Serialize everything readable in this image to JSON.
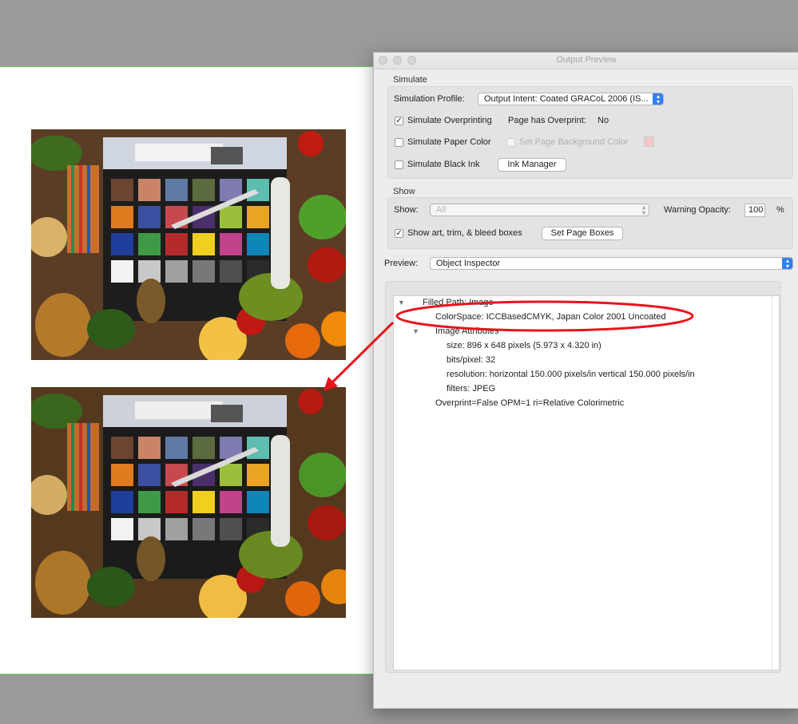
{
  "window": {
    "title": "Output Preview"
  },
  "simulate": {
    "group_label": "Simulate",
    "profile_label": "Simulation Profile:",
    "profile_value": "Output Intent: Coated GRACoL 2006 (IS...",
    "overprinting_label": "Simulate Overprinting",
    "overprinting_checked": true,
    "page_overprint_label": "Page has Overprint:",
    "page_overprint_value": "No",
    "paper_color_label": "Simulate Paper Color",
    "page_bg_label": "Set Page Background Color",
    "page_bg_color": "#f3c8c8",
    "black_ink_label": "Simulate Black Ink",
    "ink_manager_label": "Ink Manager"
  },
  "show": {
    "group_label": "Show",
    "show_label": "Show:",
    "show_value": "All",
    "warning_opacity_label": "Warning Opacity:",
    "warning_opacity_value": "100",
    "percent_label": "%",
    "boxes_label": "Show art, trim, & bleed boxes",
    "boxes_checked": true,
    "set_page_boxes_label": "Set Page Boxes"
  },
  "preview": {
    "label": "Preview:",
    "value": "Object Inspector"
  },
  "inspector": {
    "root": "Filled Path: Image",
    "colorspace": "ColorSpace: ICCBasedCMYK, Japan Color 2001 Uncoated",
    "image_attributes": "Image Attributes",
    "size": "size: 896 x 648 pixels (5.973 x 4.320 in)",
    "bits": "bits/pixel: 32",
    "resolution": "resolution: horizontal 150.000 pixels/in vertical 150.000 pixels/in",
    "filters": "filters: JPEG",
    "overprint": "Overprint=False OPM=1 ri=Relative Colorimetric"
  },
  "colors": {
    "annotation_red": "#e8141b",
    "accent_blue": "#2f7ff6",
    "page_green_border": "#5fd35f"
  }
}
